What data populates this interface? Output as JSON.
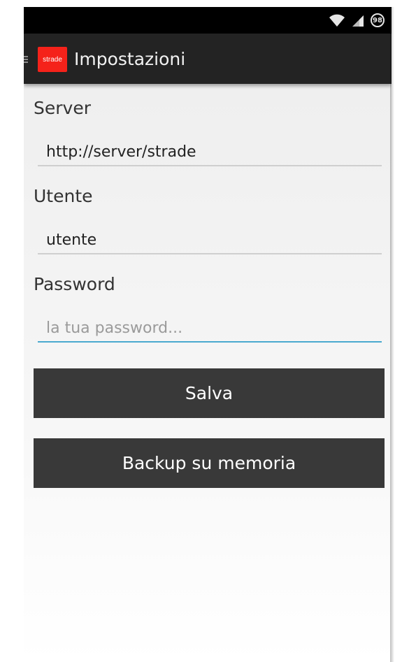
{
  "status_bar": {
    "battery_level": "98",
    "icons": [
      "wifi-icon",
      "signal-icon",
      "battery-icon"
    ]
  },
  "action_bar": {
    "logo_text": "strade",
    "title": "Impostazioni",
    "color": "#232323",
    "logo_color": "#f5221a"
  },
  "form": {
    "server_label": "Server",
    "server_value": "http://server/strade",
    "user_label": "Utente",
    "user_value": "utente",
    "password_label": "Password",
    "password_placeholder": "la tua password...",
    "focus_color": "#4aa9cf"
  },
  "buttons": {
    "save_label": "Salva",
    "backup_label": "Backup su memoria",
    "color": "#393939"
  }
}
